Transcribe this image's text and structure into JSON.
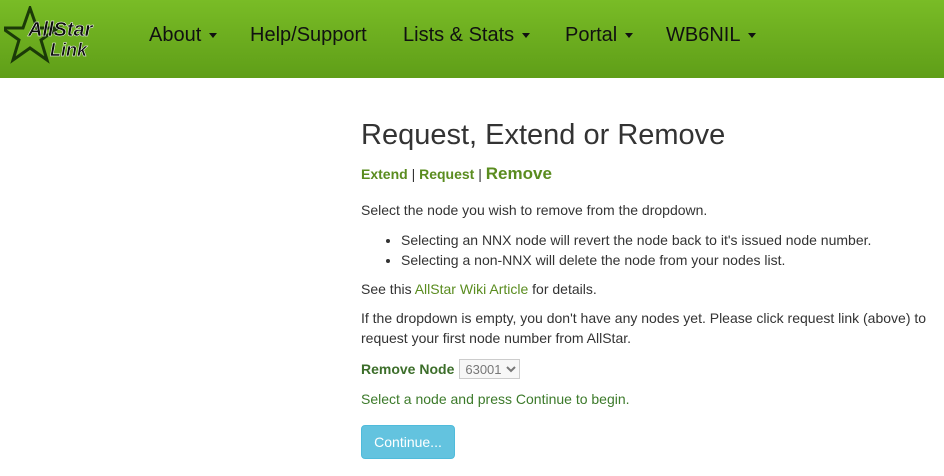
{
  "navbar": {
    "logo": {
      "line1": "AllStar",
      "line2": "Link"
    },
    "items": [
      {
        "label": "About",
        "dropdown": true
      },
      {
        "label": "Help/Support",
        "dropdown": false
      },
      {
        "label": "Lists & Stats",
        "dropdown": true
      },
      {
        "label": "Portal",
        "dropdown": true
      },
      {
        "label": "WB6NIL",
        "dropdown": true
      }
    ]
  },
  "main": {
    "title": "Request, Extend or Remove",
    "tabs": {
      "extend": "Extend",
      "request": "Request",
      "remove": "Remove",
      "separator": "|"
    },
    "intro": "Select the node you wish to remove from the dropdown.",
    "bullets": [
      "Selecting an NNX node will revert the node back to it's issued node number.",
      "Selecting a non-NNX will delete the node from your nodes list."
    ],
    "wiki": {
      "prefix": "See this ",
      "link": "AllStar Wiki Article",
      "suffix": " for details."
    },
    "empty_note": "If the dropdown is empty, you don't have any nodes yet. Please click request link (above) to request your first node number from AllStar.",
    "form": {
      "label": "Remove Node",
      "selected": "63001"
    },
    "hint": "Select a node and press Continue to begin.",
    "continue_label": "Continue..."
  },
  "colors": {
    "navbar_top": "#79bc26",
    "navbar_bottom": "#5f9e18",
    "link_green": "#5a8c1f",
    "label_green": "#3c6e2a",
    "button_bg": "#5bc0de"
  }
}
